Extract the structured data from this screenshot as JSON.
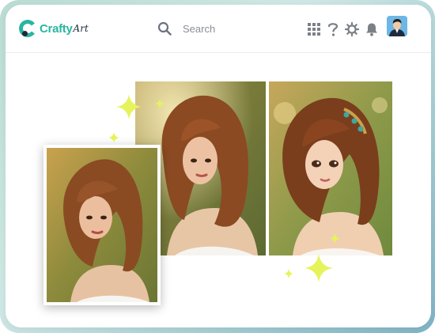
{
  "app": {
    "brand_primary": "Crafty",
    "brand_suffix": "Art",
    "brand_color": "#29b6a0"
  },
  "search": {
    "label": "Search",
    "icon": "search-icon"
  },
  "toolbar": {
    "icons": [
      "apps-grid-icon",
      "help-icon",
      "settings-icon",
      "notification-bell-icon"
    ]
  },
  "user": {
    "avatar": "user-avatar"
  },
  "gallery": {
    "images": [
      "original-portrait-photo",
      "painted-transition-portrait",
      "anime-style-portrait"
    ],
    "decoration_color": "#e6f35a"
  }
}
